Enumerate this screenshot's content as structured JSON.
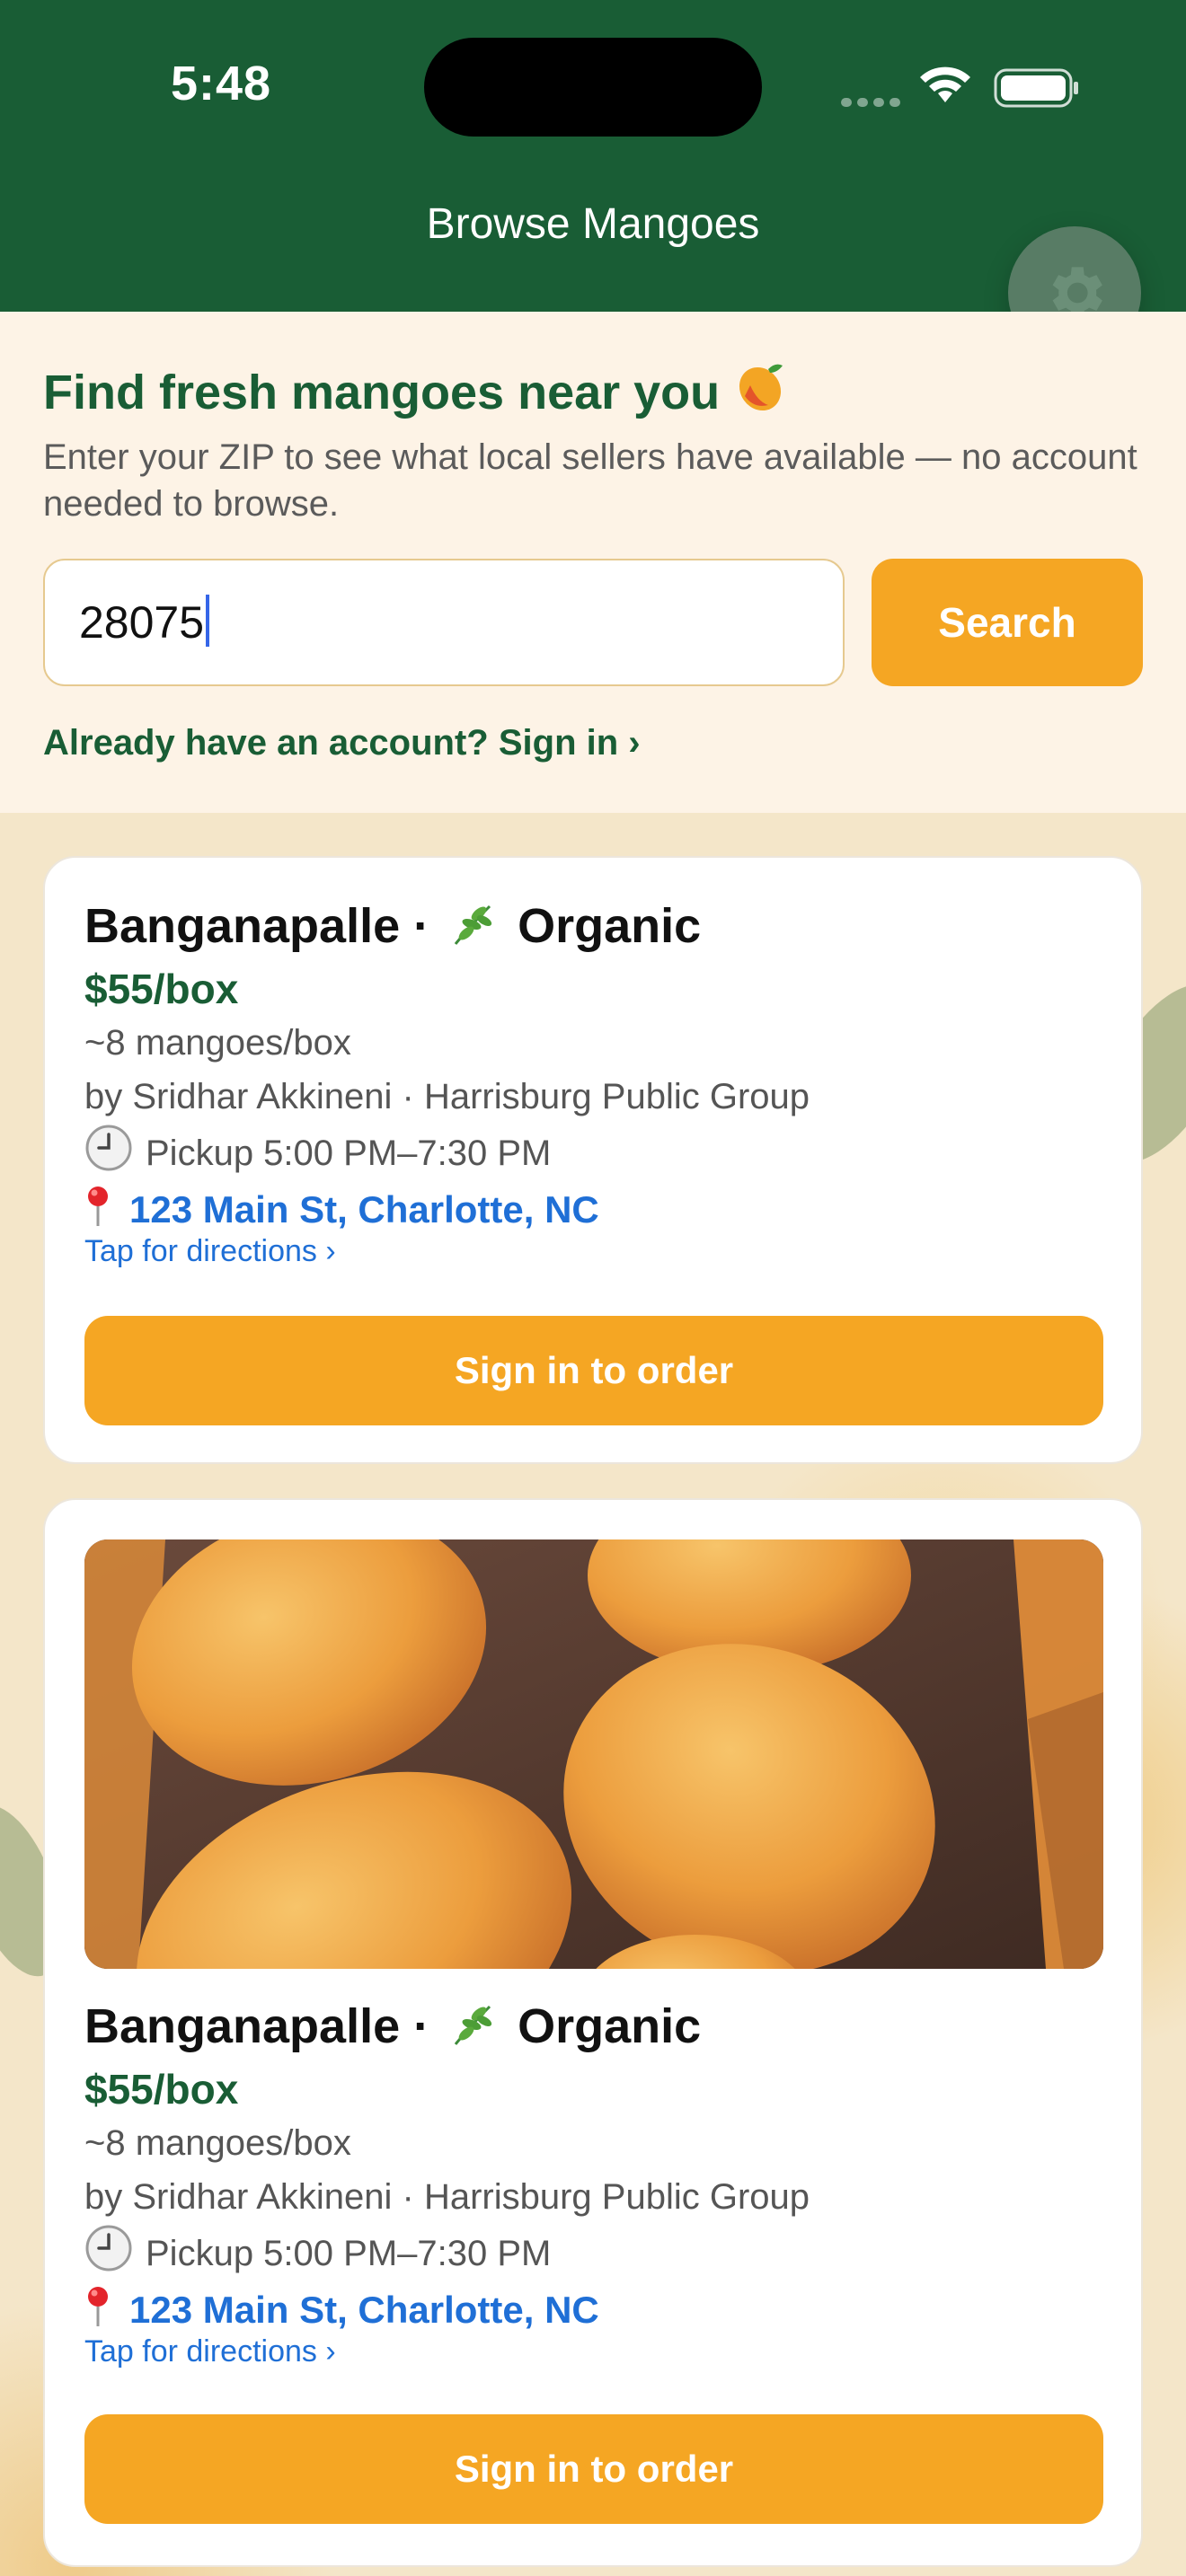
{
  "status_bar": {
    "time": "5:48"
  },
  "header": {
    "title": "Browse Mangoes",
    "settings_icon": "gear-icon"
  },
  "hero": {
    "title": "Find fresh mangoes near you",
    "title_icon": "mango-icon",
    "subtitle": "Enter your ZIP to see what local sellers have available — no account needed to browse.",
    "zip_value": "28075",
    "search_label": "Search",
    "signin_link": "Already have an account? Sign in ›"
  },
  "listings": [
    {
      "variety": "Banganapalle",
      "separator": "·",
      "tag": "Organic",
      "price": "$55/box",
      "count": "~8 mangoes/box",
      "seller": "by Sridhar Akkineni · Harrisburg Public Group",
      "pickup": "Pickup 5:00 PM–7:30 PM",
      "address": "123 Main St, Charlotte, NC",
      "directions": "Tap for directions ›",
      "cta": "Sign in to order",
      "has_photo": false
    },
    {
      "variety": "Banganapalle",
      "separator": "·",
      "tag": "Organic",
      "price": "$55/box",
      "count": "~8 mangoes/box",
      "seller": "by Sridhar Akkineni · Harrisburg Public Group",
      "pickup": "Pickup 5:00 PM–7:30 PM",
      "address": "123 Main St, Charlotte, NC",
      "directions": "Tap for directions ›",
      "cta": "Sign in to order",
      "has_photo": true
    }
  ],
  "colors": {
    "brand_green": "#195d35",
    "accent_orange": "#f5a623",
    "link_blue": "#1f6fd6"
  }
}
